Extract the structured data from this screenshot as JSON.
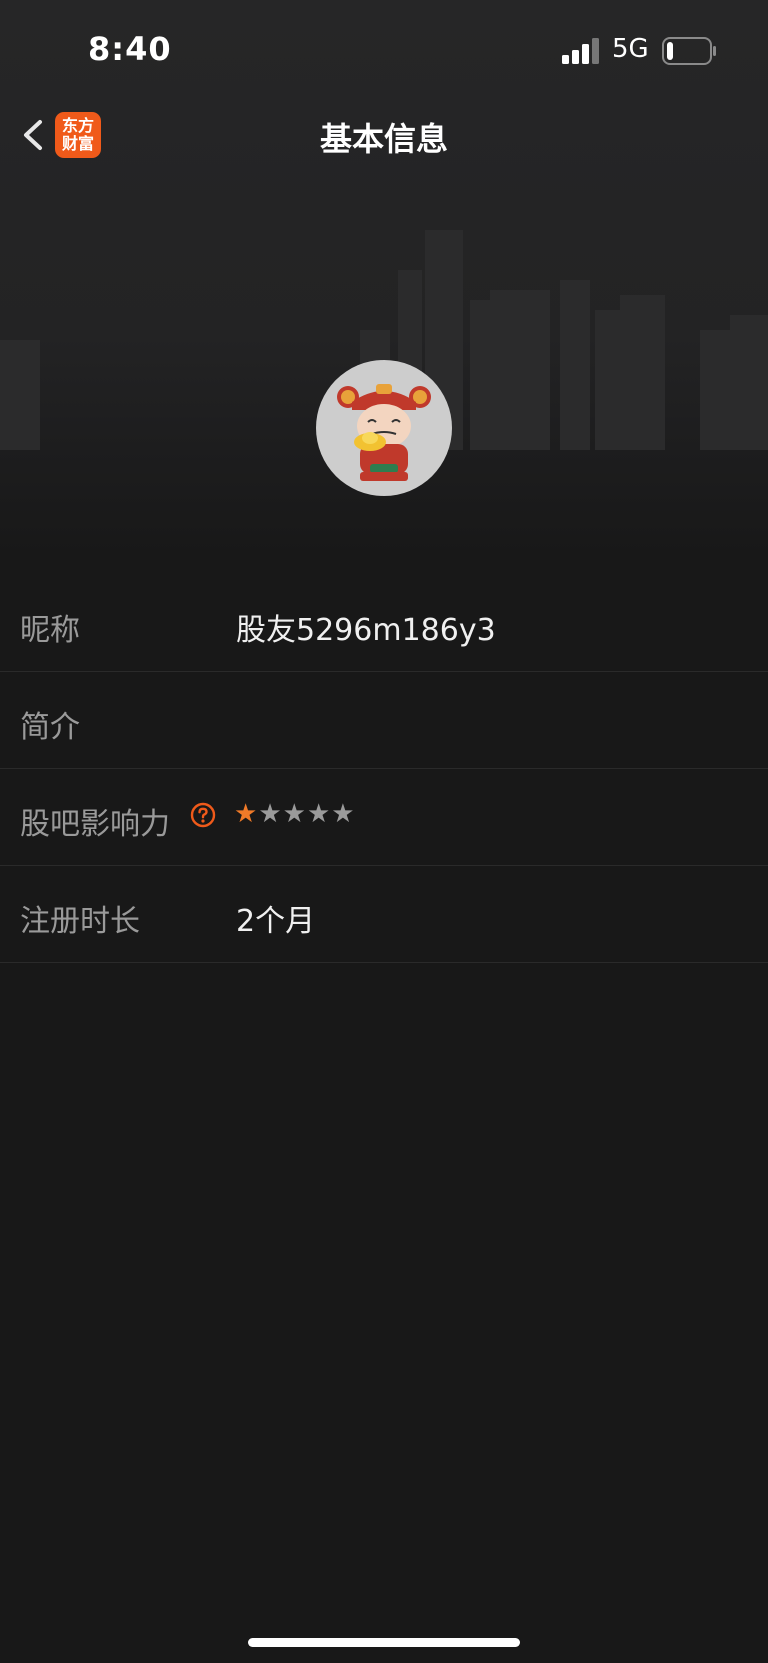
{
  "status_bar": {
    "time": "8:40",
    "network": "5G",
    "battery_level": 0.15
  },
  "nav": {
    "title": "基本信息",
    "app_logo_line1": "东方",
    "app_logo_line2": "财富"
  },
  "profile": {
    "avatar_icon": "god-of-wealth-avatar"
  },
  "rows": [
    {
      "label": "昵称",
      "value": "股友5296m186y3"
    },
    {
      "label": "简介",
      "value": ""
    },
    {
      "label": "股吧影响力",
      "help_icon": "question-circle-icon",
      "rating": 1,
      "rating_max": 5
    },
    {
      "label": "注册时长",
      "value": "2个月"
    }
  ],
  "colors": {
    "background": "#181818",
    "accent": "#f05a1a",
    "star_on": "#f07a28",
    "star_off": "#9a9a9a"
  }
}
